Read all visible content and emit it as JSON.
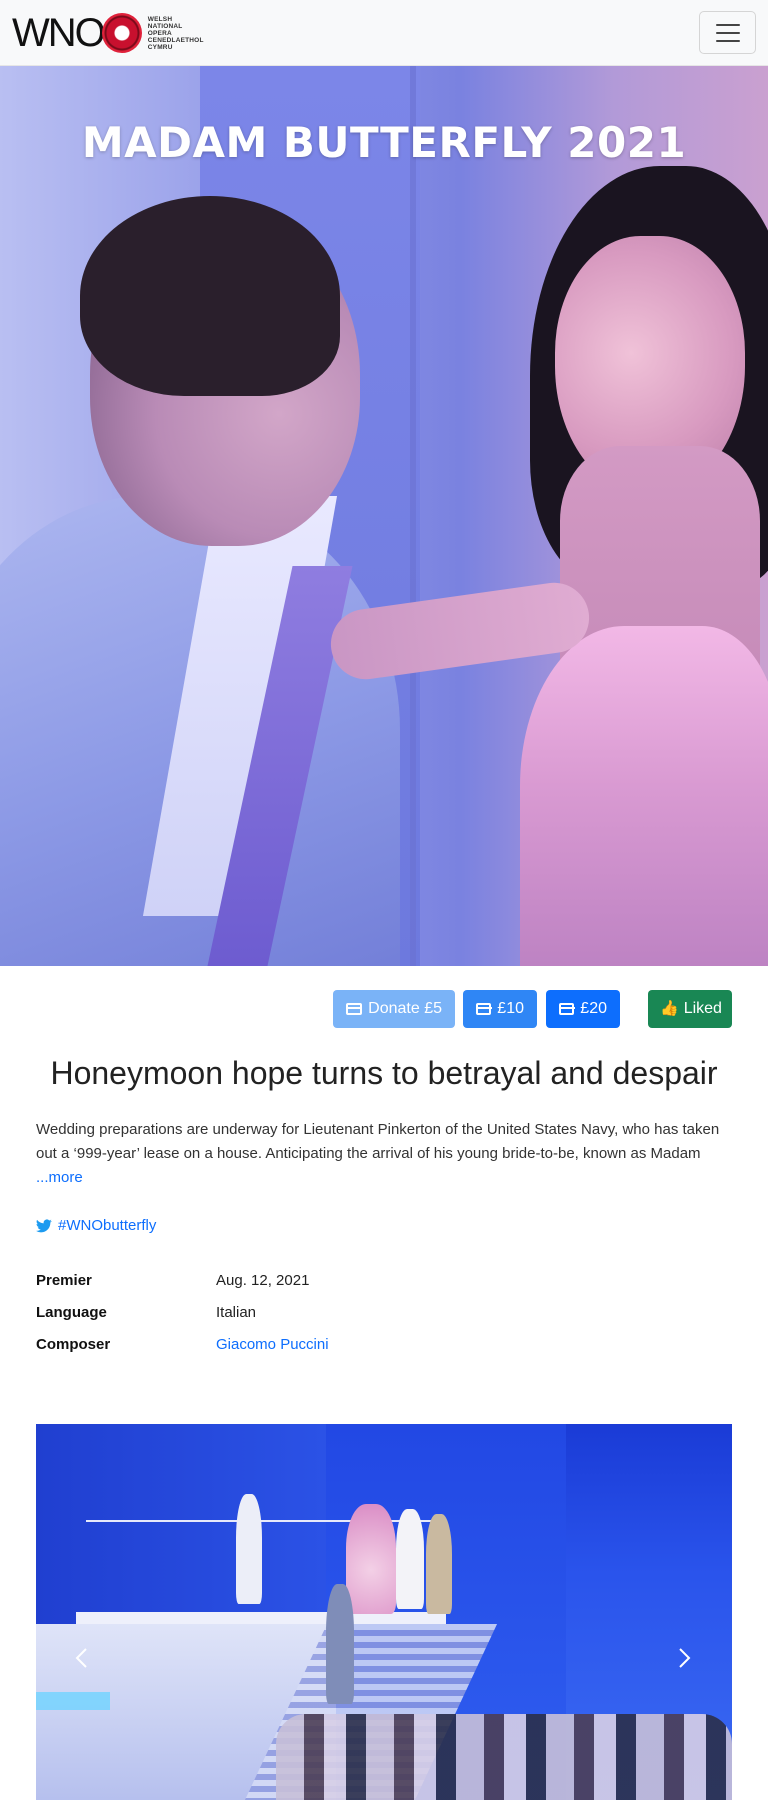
{
  "navbar": {
    "logo_text": "WNO",
    "logo_subtitle_lines": [
      "WELSH",
      "NATIONAL",
      "OPERA",
      "CENEDLAETHOL",
      "CYMRU"
    ],
    "menu_toggle_icon": "hamburger-icon"
  },
  "hero": {
    "title": "MADAM BUTTERFLY 2021"
  },
  "actions": {
    "donate5_label": "Donate £5",
    "donate10_label": "£10",
    "donate20_label": "£20",
    "liked_label": "Liked",
    "donate_icon": "credit-card-icon",
    "liked_icon": "thumbs-up-icon",
    "colors": {
      "donate5": "#7ab3f7",
      "donate10": "#2f86f5",
      "donate20": "#0d6efd",
      "liked": "#198754"
    }
  },
  "article": {
    "headline": "Honeymoon hope turns to betrayal and despair",
    "synopsis": "Wedding preparations are underway for Lieutenant Pinkerton of the United States Navy, who has taken out a ‘999-year’ lease on a house. Anticipating the arrival of his young bride-to-be, known as Madam ",
    "more_link": "...more",
    "hashtag": "#WNObutterfly"
  },
  "facts": [
    {
      "label": "Premier",
      "value": "Aug. 12, 2021"
    },
    {
      "label": "Language",
      "value": "Italian"
    },
    {
      "label": "Composer",
      "value": "Giacomo Puccini"
    }
  ],
  "carousel": {
    "prev_icon": "chevron-left-icon",
    "next_icon": "chevron-right-icon"
  }
}
